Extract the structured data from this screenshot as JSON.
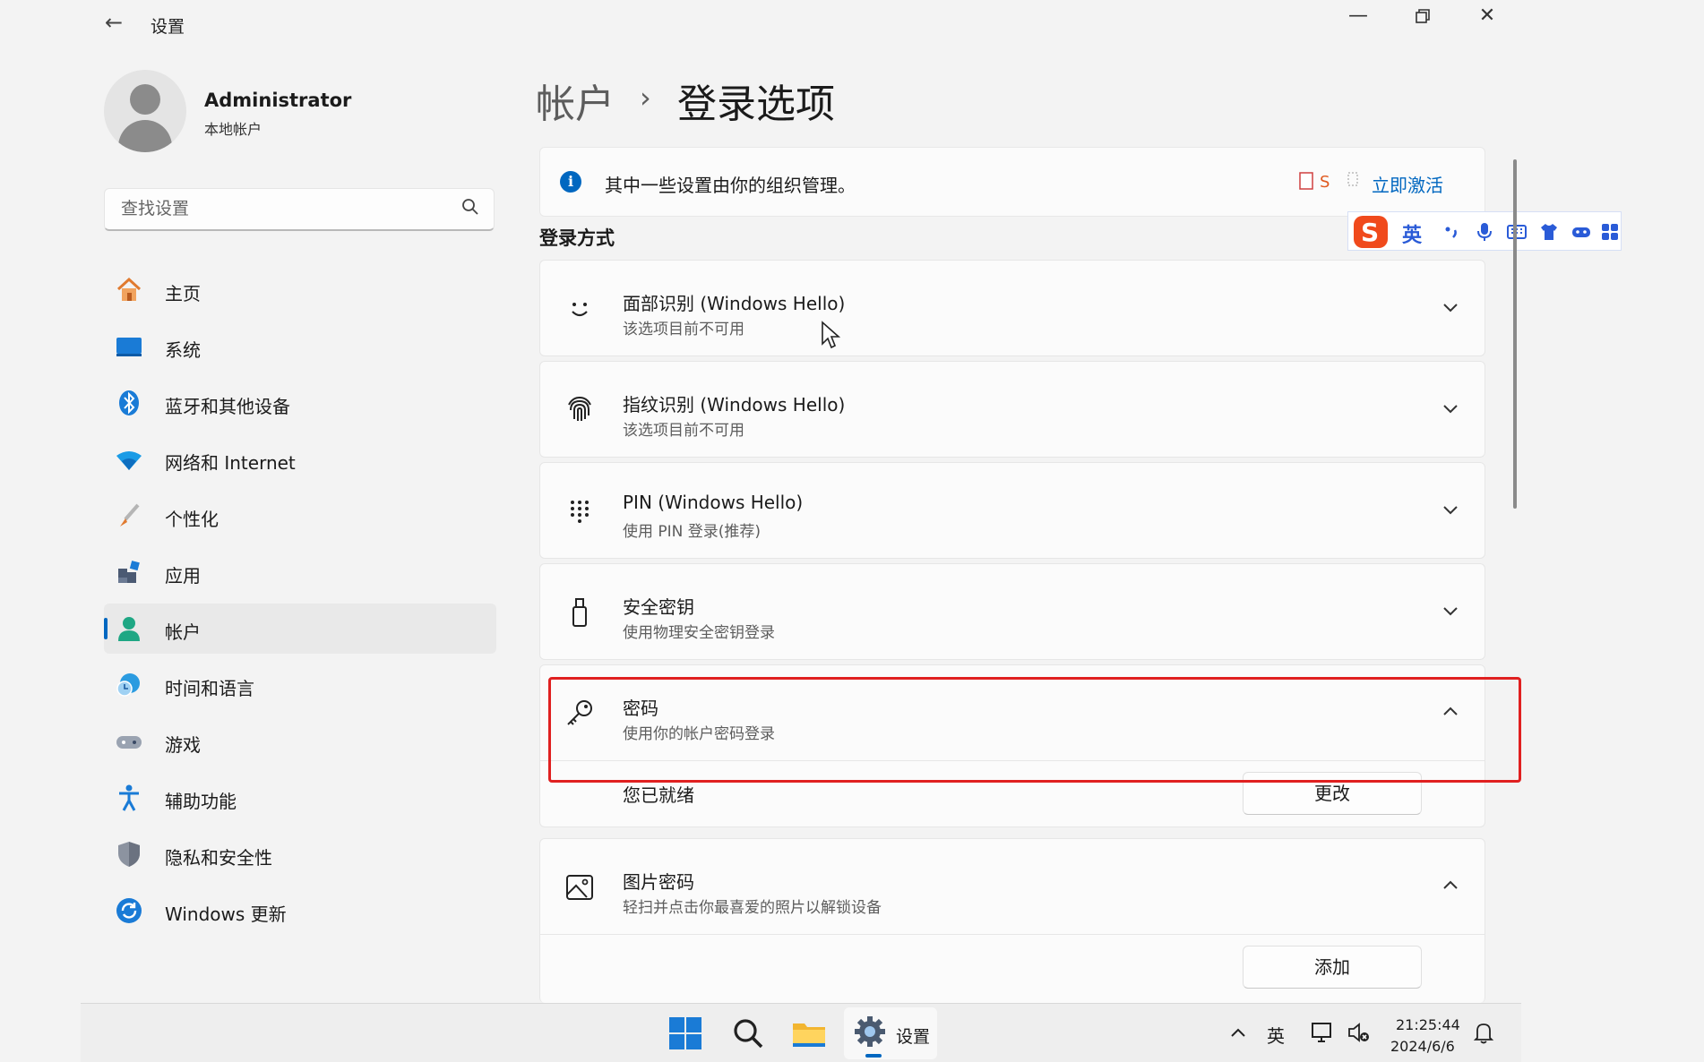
{
  "window": {
    "title": "设置"
  },
  "profile": {
    "name": "Administrator",
    "account_type": "本地帐户"
  },
  "search": {
    "placeholder": "查找设置"
  },
  "sidebar": {
    "items": [
      {
        "label": "主页",
        "icon": "home-icon"
      },
      {
        "label": "系统",
        "icon": "system-icon"
      },
      {
        "label": "蓝牙和其他设备",
        "icon": "bluetooth-icon"
      },
      {
        "label": "网络和 Internet",
        "icon": "wifi-icon"
      },
      {
        "label": "个性化",
        "icon": "brush-icon"
      },
      {
        "label": "应用",
        "icon": "apps-icon"
      },
      {
        "label": "帐户",
        "icon": "account-icon",
        "active": true
      },
      {
        "label": "时间和语言",
        "icon": "clock-globe-icon"
      },
      {
        "label": "游戏",
        "icon": "gamepad-icon"
      },
      {
        "label": "辅助功能",
        "icon": "accessibility-icon"
      },
      {
        "label": "隐私和安全性",
        "icon": "shield-icon"
      },
      {
        "label": "Windows 更新",
        "icon": "update-icon"
      }
    ]
  },
  "breadcrumb": {
    "parent": "帐户",
    "separator": "›",
    "current": "登录选项"
  },
  "info_bar": {
    "text": "其中一些设置由你的组织管理。",
    "link": "立即激活"
  },
  "section": {
    "title": "登录方式"
  },
  "sign_in_options": [
    {
      "title": "面部识别 (Windows Hello)",
      "subtitle": "该选项目前不可用",
      "icon": "face-icon",
      "expanded": false
    },
    {
      "title": "指纹识别 (Windows Hello)",
      "subtitle": "该选项目前不可用",
      "icon": "fingerprint-icon",
      "expanded": false
    },
    {
      "title": "PIN (Windows Hello)",
      "subtitle": "使用 PIN 登录(推荐)",
      "icon": "keypad-icon",
      "expanded": false
    },
    {
      "title": "安全密钥",
      "subtitle": "使用物理安全密钥登录",
      "icon": "usb-key-icon",
      "expanded": false
    },
    {
      "title": "密码",
      "subtitle": "使用你的帐户密码登录",
      "icon": "key-icon",
      "expanded": true,
      "detail_label": "您已就绪",
      "button": "更改"
    },
    {
      "title": "图片密码",
      "subtitle": "轻扫并点击你最喜爱的照片以解锁设备",
      "icon": "picture-icon",
      "expanded": true,
      "button": "添加"
    }
  ],
  "ime": {
    "lang": "英"
  },
  "taskbar": {
    "settings_label": "设置",
    "tray_lang": "英",
    "time": "21:25:44",
    "date": "2024/6/6"
  },
  "colors": {
    "accent": "#0067c0",
    "highlight": "#e02020"
  }
}
